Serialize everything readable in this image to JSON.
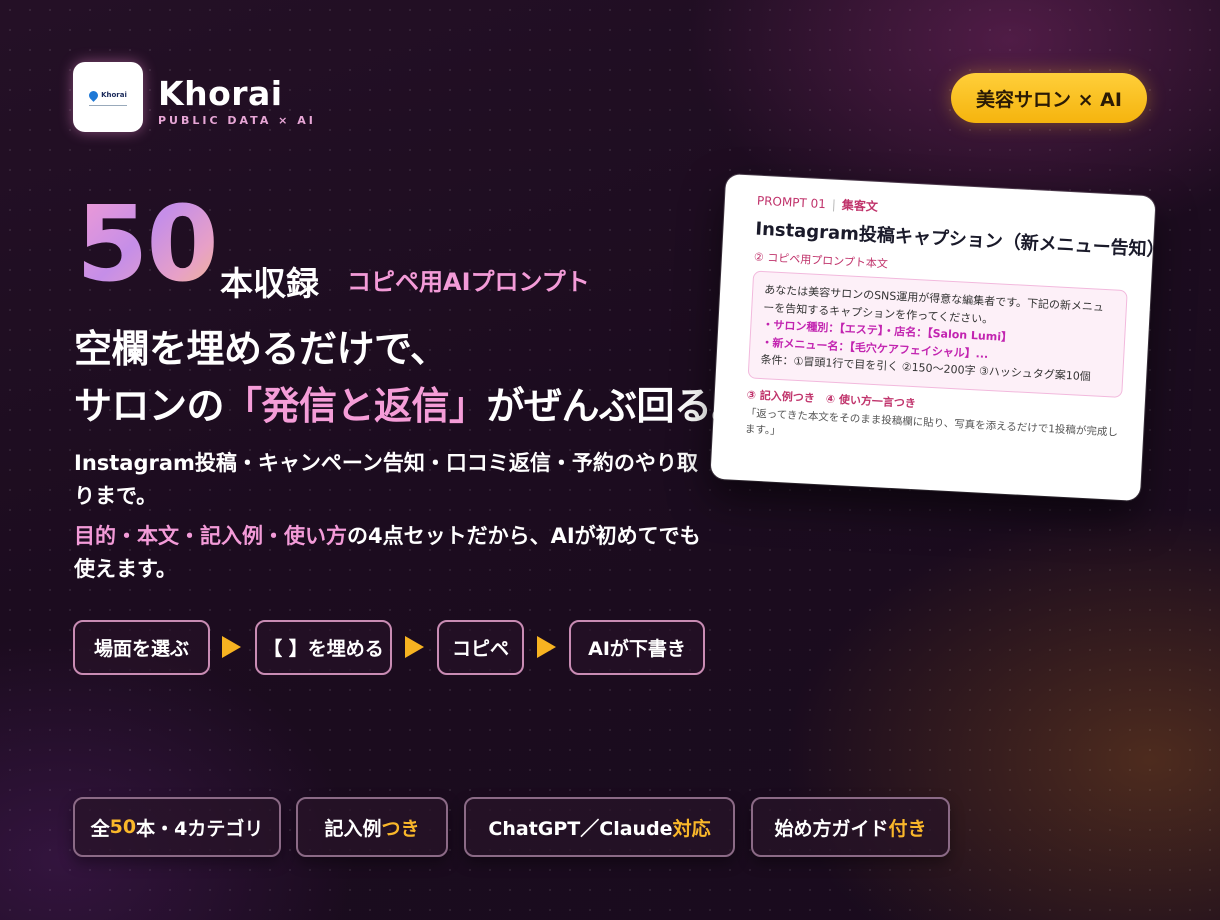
{
  "brand": {
    "logo_text": "Khorai",
    "name": "Khorai",
    "subtitle": "PUBLIC DATA × AI"
  },
  "tag": "美容サロン × AI",
  "hero": {
    "count": "50",
    "count_suffix": "本収録",
    "copipe_label": "コピペ用AIプロンプト",
    "headline_line1": "空欄を埋めるだけで、",
    "headline_line2_pre": "サロンの",
    "headline_line2_highlight": "「発信と返信」",
    "headline_line2_post": "がぜんぶ回る。"
  },
  "description": {
    "line1": "Instagram投稿・キャンペーン告知・口コミ返信・予約のやり取りまで。",
    "line2_highlight": "目的・本文・記入例・使い方",
    "line2_rest": "の4点セットだから、AIが初めてでも使えます。"
  },
  "steps": [
    "場面を選ぶ",
    "【 】を埋める",
    "コピペ",
    "AIが下書き"
  ],
  "features": [
    {
      "pre": "全",
      "accent": "50",
      "post": "本・4カテゴリ"
    },
    {
      "pre": "記入例",
      "accent": "つき",
      "post": ""
    },
    {
      "pre": "ChatGPT／Claude",
      "accent": "対応",
      "post": ""
    },
    {
      "pre": "始め方ガイド",
      "accent": "付き",
      "post": ""
    }
  ],
  "card": {
    "prompt_no": "PROMPT 01",
    "category": "集客文",
    "title": "Instagram投稿キャプション（新メニュー告知）",
    "section2": "② コピペ用プロンプト本文",
    "body_intro": "あなたは美容サロンのSNS運用が得意な編集者です。下記の新メニューを告知するキャプションを作ってください。",
    "body_field1": "・サロン種別：【エステ】・店名：【Salon Lumi】",
    "body_field2": "・新メニュー名：【毛穴ケアフェイシャル】...",
    "body_conditions": "条件：①冒頭1行で目を引く ②150〜200字 ③ハッシュタグ案10個",
    "section3": "③ 記入例つき　④ 使い方一言つき",
    "footer": "「返ってきた本文をそのまま投稿欄に貼り、写真を添えるだけで1投稿が完成します。」"
  },
  "colors": {
    "accent_pink": "#f39bd8",
    "accent_yellow": "#f9b72a",
    "background": "#1c0c1f"
  }
}
